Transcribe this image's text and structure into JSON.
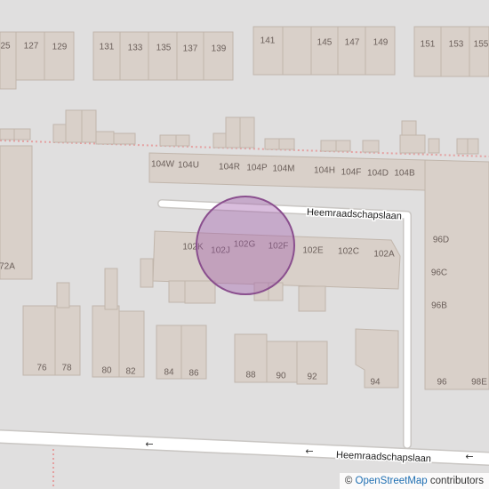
{
  "map": {
    "street_name": "Heemraadschapslaan",
    "one_way_arrow": "←",
    "marker_color": "#a05aaa",
    "house_numbers": [
      "25",
      "127",
      "129",
      "131",
      "133",
      "135",
      "137",
      "139",
      "141",
      "145",
      "147",
      "149",
      "151",
      "153",
      "155",
      "104W",
      "104U",
      "104R",
      "104P",
      "104M",
      "104H",
      "104F",
      "104D",
      "104B",
      "102K",
      "102J",
      "102G",
      "102F",
      "102E",
      "102C",
      "102A",
      "96D",
      "96C",
      "96B",
      "96",
      "98E",
      "72A",
      "76",
      "78",
      "80",
      "82",
      "84",
      "86",
      "88",
      "90",
      "92",
      "94"
    ]
  },
  "attribution": {
    "copyright": "©",
    "link_text": "OpenStreetMap",
    "suffix": "contributors"
  }
}
